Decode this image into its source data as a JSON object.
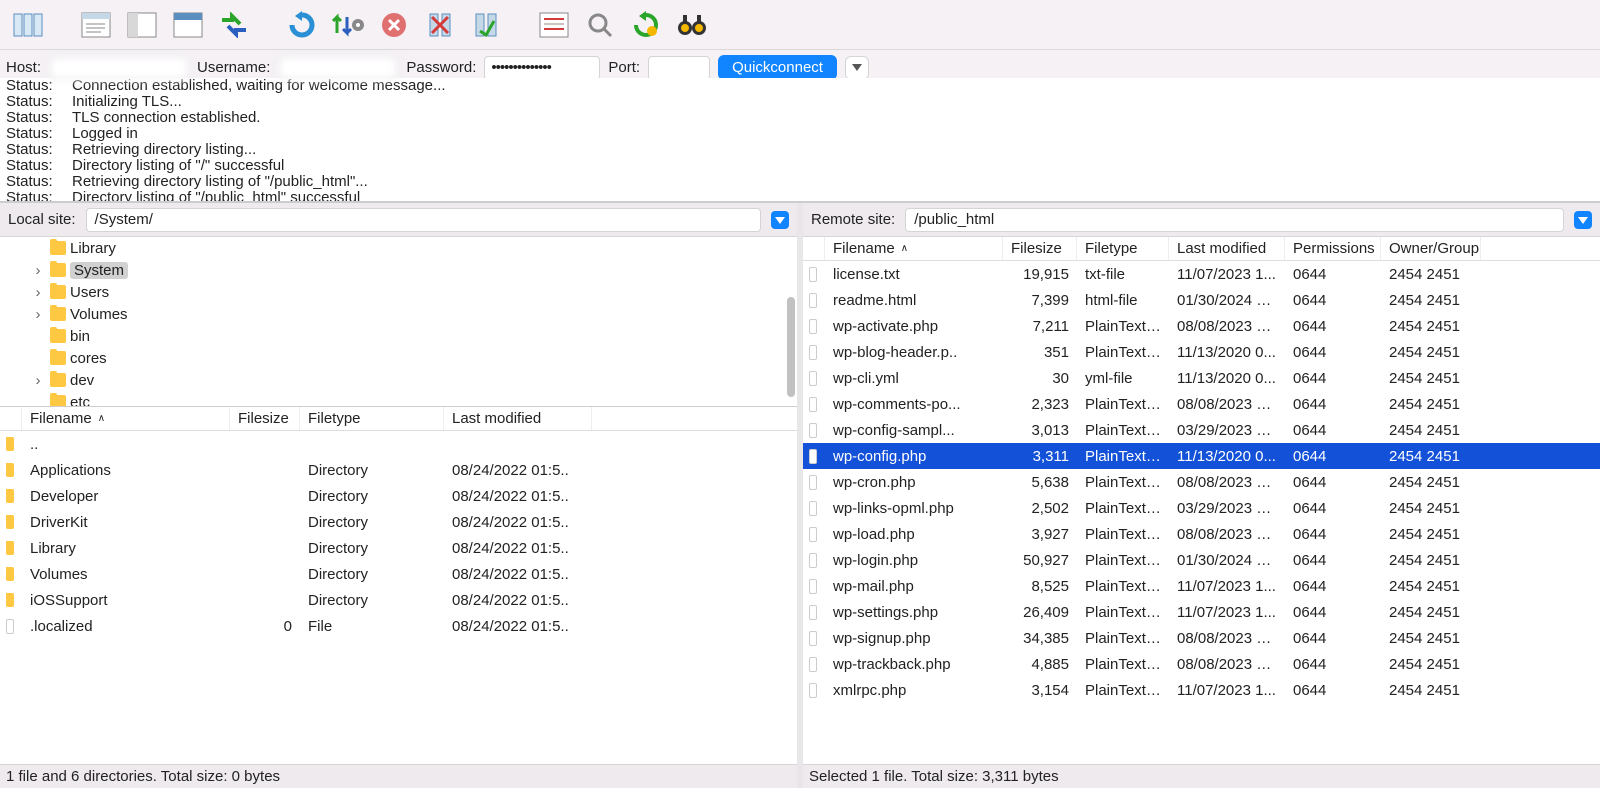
{
  "conn": {
    "host_label": "Host:",
    "user_label": "Username:",
    "pass_label": "Password:",
    "port_label": "Port:",
    "pass_value": "••••••••••••••",
    "quickconnect": "Quickconnect"
  },
  "log": [
    {
      "l": "Status:",
      "m": "Connection established, waiting for welcome message..."
    },
    {
      "l": "Status:",
      "m": "Initializing TLS..."
    },
    {
      "l": "Status:",
      "m": "TLS connection established."
    },
    {
      "l": "Status:",
      "m": "Logged in"
    },
    {
      "l": "Status:",
      "m": "Retrieving directory listing..."
    },
    {
      "l": "Status:",
      "m": "Directory listing of \"/\" successful"
    },
    {
      "l": "Status:",
      "m": "Retrieving directory listing of \"/public_html\"..."
    },
    {
      "l": "Status:",
      "m": "Directory listing of \"/public_html\" successful"
    }
  ],
  "local": {
    "label": "Local site:",
    "path": "/System/",
    "tree": [
      {
        "tw": "",
        "name": "Library",
        "sel": false,
        "indent": 1
      },
      {
        "tw": "›",
        "name": "System",
        "sel": true,
        "indent": 1
      },
      {
        "tw": "›",
        "name": "Users",
        "sel": false,
        "indent": 1
      },
      {
        "tw": "›",
        "name": "Volumes",
        "sel": false,
        "indent": 1
      },
      {
        "tw": "",
        "name": "bin",
        "sel": false,
        "indent": 1
      },
      {
        "tw": "",
        "name": "cores",
        "sel": false,
        "indent": 1
      },
      {
        "tw": "›",
        "name": "dev",
        "sel": false,
        "indent": 1
      },
      {
        "tw": "",
        "name": "etc",
        "sel": false,
        "indent": 1
      }
    ],
    "cols": [
      "Filename",
      "Filesize",
      "Filetype",
      "Last modified"
    ],
    "files": [
      {
        "n": "..",
        "s": "",
        "t": "",
        "m": "",
        "folder": true
      },
      {
        "n": "Applications",
        "s": "",
        "t": "Directory",
        "m": "08/24/2022 01:5..",
        "folder": true
      },
      {
        "n": "Developer",
        "s": "",
        "t": "Directory",
        "m": "08/24/2022 01:5..",
        "folder": true
      },
      {
        "n": "DriverKit",
        "s": "",
        "t": "Directory",
        "m": "08/24/2022 01:5..",
        "folder": true
      },
      {
        "n": "Library",
        "s": "",
        "t": "Directory",
        "m": "08/24/2022 01:5..",
        "folder": true
      },
      {
        "n": "Volumes",
        "s": "",
        "t": "Directory",
        "m": "08/24/2022 01:5..",
        "folder": true
      },
      {
        "n": "iOSSupport",
        "s": "",
        "t": "Directory",
        "m": "08/24/2022 01:5..",
        "folder": true
      },
      {
        "n": ".localized",
        "s": "0",
        "t": "File",
        "m": "08/24/2022 01:5..",
        "folder": false
      }
    ],
    "status": "1 file and 6 directories. Total size: 0 bytes"
  },
  "remote": {
    "label": "Remote site:",
    "path": "/public_html",
    "cols": [
      "Filename",
      "Filesize",
      "Filetype",
      "Last modified",
      "Permissions",
      "Owner/Group"
    ],
    "files": [
      {
        "n": "license.txt",
        "s": "19,915",
        "t": "txt-file",
        "m": "11/07/2023 1...",
        "p": "0644",
        "o": "2454 2451",
        "sel": false
      },
      {
        "n": "readme.html",
        "s": "7,399",
        "t": "html-file",
        "m": "01/30/2024 1...",
        "p": "0644",
        "o": "2454 2451",
        "sel": false
      },
      {
        "n": "wp-activate.php",
        "s": "7,211",
        "t": "PlainTextT..",
        "m": "08/08/2023 1...",
        "p": "0644",
        "o": "2454 2451",
        "sel": false
      },
      {
        "n": "wp-blog-header.p..",
        "s": "351",
        "t": "PlainTextT..",
        "m": "11/13/2020 0...",
        "p": "0644",
        "o": "2454 2451",
        "sel": false
      },
      {
        "n": "wp-cli.yml",
        "s": "30",
        "t": "yml-file",
        "m": "11/13/2020 0...",
        "p": "0644",
        "o": "2454 2451",
        "sel": false
      },
      {
        "n": "wp-comments-po...",
        "s": "2,323",
        "t": "PlainTextT..",
        "m": "08/08/2023 1...",
        "p": "0644",
        "o": "2454 2451",
        "sel": false
      },
      {
        "n": "wp-config-sampl...",
        "s": "3,013",
        "t": "PlainTextT..",
        "m": "03/29/2023 1...",
        "p": "0644",
        "o": "2454 2451",
        "sel": false
      },
      {
        "n": "wp-config.php",
        "s": "3,311",
        "t": "PlainTextT..",
        "m": "11/13/2020 0...",
        "p": "0644",
        "o": "2454 2451",
        "sel": true
      },
      {
        "n": "wp-cron.php",
        "s": "5,638",
        "t": "PlainTextT..",
        "m": "08/08/2023 1...",
        "p": "0644",
        "o": "2454 2451",
        "sel": false
      },
      {
        "n": "wp-links-opml.php",
        "s": "2,502",
        "t": "PlainTextT..",
        "m": "03/29/2023 1...",
        "p": "0644",
        "o": "2454 2451",
        "sel": false
      },
      {
        "n": "wp-load.php",
        "s": "3,927",
        "t": "PlainTextT..",
        "m": "08/08/2023 1...",
        "p": "0644",
        "o": "2454 2451",
        "sel": false
      },
      {
        "n": "wp-login.php",
        "s": "50,927",
        "t": "PlainTextT..",
        "m": "01/30/2024 1...",
        "p": "0644",
        "o": "2454 2451",
        "sel": false
      },
      {
        "n": "wp-mail.php",
        "s": "8,525",
        "t": "PlainTextT..",
        "m": "11/07/2023 1...",
        "p": "0644",
        "o": "2454 2451",
        "sel": false
      },
      {
        "n": "wp-settings.php",
        "s": "26,409",
        "t": "PlainTextT..",
        "m": "11/07/2023 1...",
        "p": "0644",
        "o": "2454 2451",
        "sel": false
      },
      {
        "n": "wp-signup.php",
        "s": "34,385",
        "t": "PlainTextT..",
        "m": "08/08/2023 1...",
        "p": "0644",
        "o": "2454 2451",
        "sel": false
      },
      {
        "n": "wp-trackback.php",
        "s": "4,885",
        "t": "PlainTextT..",
        "m": "08/08/2023 1...",
        "p": "0644",
        "o": "2454 2451",
        "sel": false
      },
      {
        "n": "xmlrpc.php",
        "s": "3,154",
        "t": "PlainTextT..",
        "m": "11/07/2023 1...",
        "p": "0644",
        "o": "2454 2451",
        "sel": false
      }
    ],
    "status": "Selected 1 file. Total size: 3,311 bytes"
  }
}
